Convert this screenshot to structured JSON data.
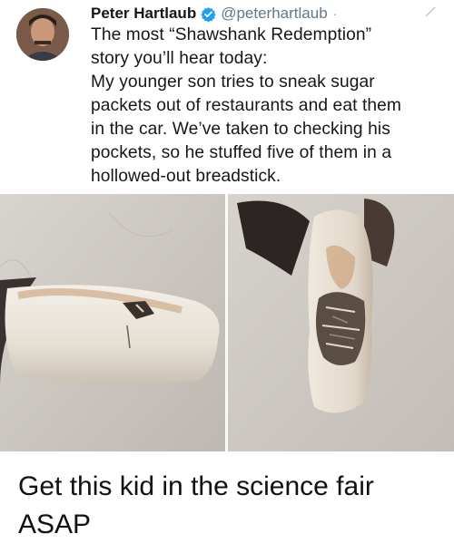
{
  "tweet": {
    "author_name": "Peter Hartlaub",
    "handle": "@peterhartlaub",
    "separator": "·",
    "text": "The most “Shawshank Redemption”\nstory you’ll hear today:\nMy younger son tries to sneak sugar\npackets out of restaurants and eat them\nin the car. We’ve taken to checking his\npockets, so he stuffed five of them in a\nhollowed-out breadstick.",
    "verified_color": "#1da1f2"
  },
  "icons": {
    "verified": "verified-badge-icon",
    "caret": "chevron-down-icon"
  },
  "meme": {
    "caption": "Get this kid in the science fair\nASAP"
  }
}
